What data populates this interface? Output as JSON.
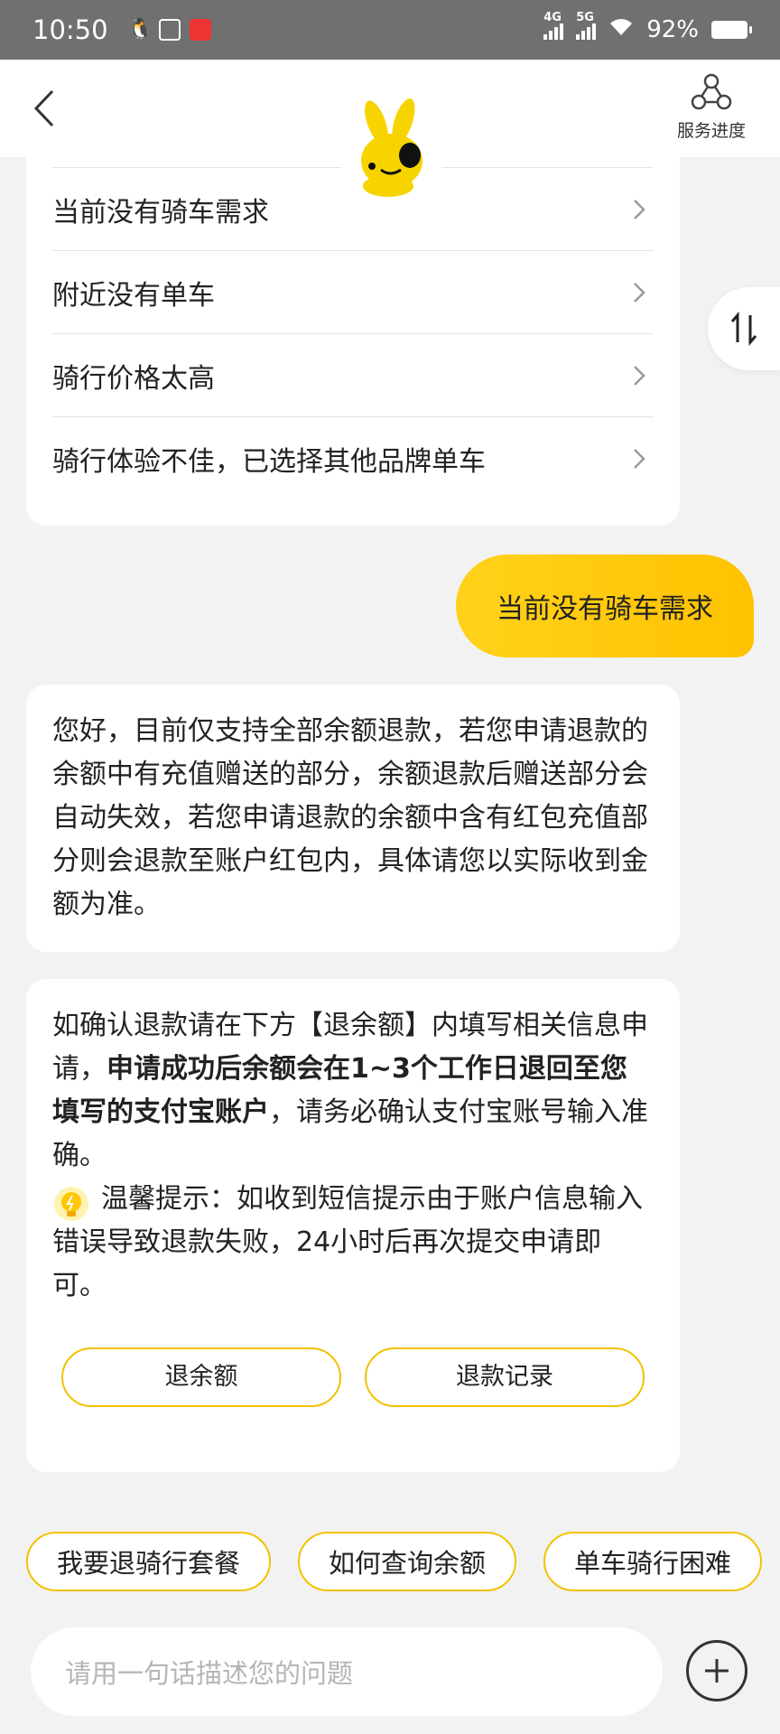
{
  "status_bar": {
    "time": "10:50",
    "net1": "4G",
    "net2": "5G",
    "battery": "92%"
  },
  "header": {
    "back_icon": "chevron-left-icon",
    "service_label": "服务进度",
    "service_icon": "network-nodes-icon"
  },
  "options": [
    {
      "label": "当前没有骑车需求"
    },
    {
      "label": "附近没有单车"
    },
    {
      "label": "骑行价格太高"
    },
    {
      "label": "骑行体验不佳，已选择其他品牌单车"
    }
  ],
  "user_message": "当前没有骑车需求",
  "messages": {
    "msg1": "您好，目前仅支持全部余额退款，若您申请退款的余额中有充值赠送的部分，余额退款后赠送部分会自动失效，若您申请退款的余额中含有红包充值部分则会退款至账户红包内，具体请您以实际收到金额为准。",
    "msg2_part1": "如确认退款请在下方【退余额】内填写相关信息申请，",
    "msg2_bold": "申请成功后余额会在1~3个工作日退回至您填写的支付宝账户",
    "msg2_part2": "，请务必确认支付宝账号输入准确。",
    "tip": "温馨提示：如收到短信提示由于账户信息输入错误导致退款失败，24小时后再次提交申请即可。"
  },
  "actions": {
    "refund_balance": "退余额",
    "refund_record": "退款记录"
  },
  "chips": [
    {
      "label": "我要退骑行套餐"
    },
    {
      "label": "如何查询余额"
    },
    {
      "label": "单车骑行困难"
    }
  ],
  "input": {
    "placeholder": "请用一句话描述您的问题"
  },
  "colors": {
    "accent": "#ffc800",
    "background": "#f2f2f2"
  }
}
